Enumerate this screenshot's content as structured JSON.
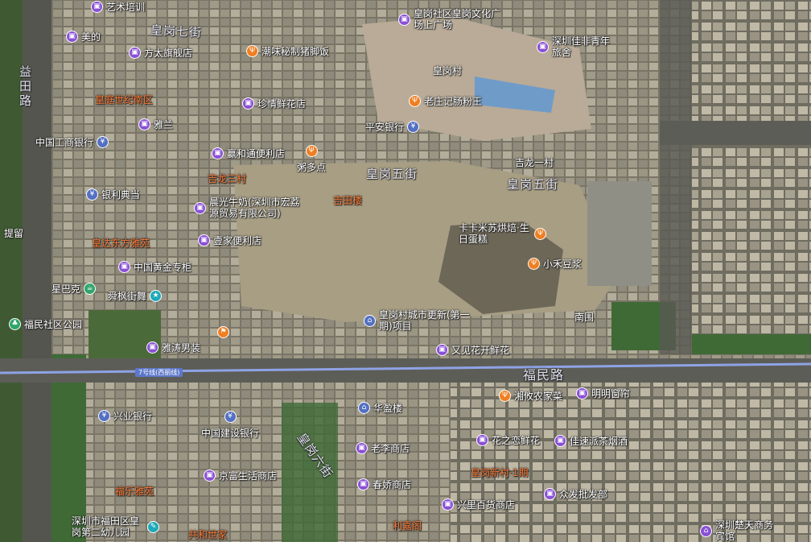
{
  "colors": {
    "shopping": "#8a50d6",
    "food": "#ef7f22",
    "bank": "#5370c2",
    "leisure": "#1fa9b9",
    "park": "#2fa56a",
    "area_label": "#ff7a33",
    "metro_line": "#8ea3e6"
  },
  "roads": {
    "fumin": "福民路",
    "huanggang7": "皇岗七街",
    "huanggang5": "皇岗五街",
    "yitian": "益田路",
    "huanggang5b": "皇岗五街",
    "huangganglu": "皇岗六街"
  },
  "metro_line_label": "7号线(西丽线)",
  "pois": [
    {
      "id": "art",
      "label": "艺术培训",
      "icon": "shopping-bag-icon",
      "kind": "shopping"
    },
    {
      "id": "meide",
      "label": "美的",
      "icon": "shopping-bag-icon",
      "kind": "shopping"
    },
    {
      "id": "fangtai",
      "label": "方太旗舰店",
      "icon": "shopping-bag-icon",
      "kind": "shopping"
    },
    {
      "id": "yalan",
      "label": "雅兰",
      "icon": "shopping-bag-icon",
      "kind": "shopping"
    },
    {
      "id": "icbc",
      "label": "中国工商银行",
      "icon": "bank-icon",
      "kind": "bank"
    },
    {
      "id": "yinli",
      "label": "银利典当",
      "icon": "bank-icon",
      "kind": "bank"
    },
    {
      "id": "gold",
      "label": "中国黄金专柜",
      "icon": "shopping-bag-icon",
      "kind": "shopping"
    },
    {
      "id": "starbucks",
      "label": "星巴克",
      "icon": "coffee-icon",
      "kind": "park"
    },
    {
      "id": "dance",
      "label": "舜枫街舞",
      "icon": "leisure-icon",
      "kind": "leisure"
    },
    {
      "id": "fumin_park",
      "label": "福民社区公园",
      "icon": "park-icon",
      "kind": "park"
    },
    {
      "id": "yatao",
      "label": "雅涛男装",
      "icon": "shopping-bag-icon",
      "kind": "shopping"
    },
    {
      "id": "chaowei",
      "label": "潮味秘制猪脚饭",
      "icon": "food-icon",
      "kind": "food"
    },
    {
      "id": "zhenqing",
      "label": "珍情鲜花店",
      "icon": "shopping-bag-icon",
      "kind": "shopping"
    },
    {
      "id": "yinghe",
      "label": "赢和通便利店",
      "icon": "shopping-bag-icon",
      "kind": "shopping"
    },
    {
      "id": "chenguang",
      "label": "晨光牛奶(深圳市宏荔源贸易有限公司)",
      "icon": "shopping-bag-icon",
      "kind": "shopping"
    },
    {
      "id": "yijia",
      "label": "壹家便利店",
      "icon": "shopping-bag-icon",
      "kind": "shopping"
    },
    {
      "id": "kfc",
      "label": "",
      "icon": "fast-food-icon",
      "kind": "food"
    },
    {
      "id": "plaza",
      "label": "皇岗社区皇岗文化广场上广场",
      "icon": "shopping-bag-icon",
      "kind": "shopping"
    },
    {
      "id": "hostel",
      "label": "深圳佳非青年旅舍",
      "icon": "shopping-bag-icon",
      "kind": "shopping"
    },
    {
      "id": "laozhuang",
      "label": "老庄记肠粉王",
      "icon": "food-icon",
      "kind": "food"
    },
    {
      "id": "pingan",
      "label": "平安银行",
      "icon": "bank-icon",
      "kind": "bank"
    },
    {
      "id": "zhouduo",
      "label": "粥多点",
      "icon": "food-icon",
      "kind": "food"
    },
    {
      "id": "kakami",
      "label": "卡卡米苏烘焙·生日蛋糕",
      "icon": "food-icon",
      "kind": "food"
    },
    {
      "id": "xiaohe",
      "label": "小禾豆浆",
      "icon": "food-icon",
      "kind": "food"
    },
    {
      "id": "renewal",
      "label": "皇岗村城市更新(第一期)项目",
      "icon": "building-icon",
      "kind": "bank"
    },
    {
      "id": "youjian",
      "label": "又见花开鲜花",
      "icon": "shopping-bag-icon",
      "kind": "shopping"
    },
    {
      "id": "xingye",
      "label": "兴业银行",
      "icon": "bank-icon",
      "kind": "bank"
    },
    {
      "id": "ccb",
      "label": "中国建设银行",
      "icon": "bank-icon",
      "kind": "bank"
    },
    {
      "id": "jingfu",
      "label": "京富生活商店",
      "icon": "shopping-bag-icon",
      "kind": "shopping"
    },
    {
      "id": "kindergarten",
      "label": "深圳市福田区皇岗第二幼儿园",
      "icon": "school-icon",
      "kind": "leisure"
    },
    {
      "id": "huaying",
      "label": "华盈楼",
      "icon": "building-icon",
      "kind": "bank"
    },
    {
      "id": "laoli",
      "label": "老李商店",
      "icon": "shopping-bag-icon",
      "kind": "shopping"
    },
    {
      "id": "chunjiao",
      "label": "春娇商店",
      "icon": "shopping-bag-icon",
      "kind": "shopping"
    },
    {
      "id": "xingli",
      "label": "兴里百货商店",
      "icon": "shopping-bag-icon",
      "kind": "shopping"
    },
    {
      "id": "xiangyou",
      "label": "湘攸农家菜",
      "icon": "food-icon",
      "kind": "food"
    },
    {
      "id": "mingming",
      "label": "明明窗帘",
      "icon": "shopping-bag-icon",
      "kind": "shopping"
    },
    {
      "id": "huazhilian",
      "label": "花之恋鲜花",
      "icon": "shopping-bag-icon",
      "kind": "shopping"
    },
    {
      "id": "jiasu",
      "label": "佳速派茶烟酒",
      "icon": "shopping-bag-icon",
      "kind": "shopping"
    },
    {
      "id": "zhongfa",
      "label": "众发批发部",
      "icon": "shopping-bag-icon",
      "kind": "shopping"
    },
    {
      "id": "chutian",
      "label": "深圳楚天商务宾馆",
      "icon": "hotel-icon",
      "kind": "shopping"
    }
  ],
  "areas": {
    "huangting": "皇庭世纪南区",
    "jilong3": "吉龙三村",
    "jitian": "吉田楼",
    "huangda": "皇达东方雅苑",
    "fule": "福乐雅苑",
    "gonghe": "共和世家",
    "huanggang_new": "皇岗新村·1期",
    "lijia": "利嘉阁"
  },
  "plain_labels": {
    "huanggang_cun": "皇岗村",
    "jilong1": "吉龙一村",
    "nanwei": "南围",
    "tiliu": "提留"
  }
}
